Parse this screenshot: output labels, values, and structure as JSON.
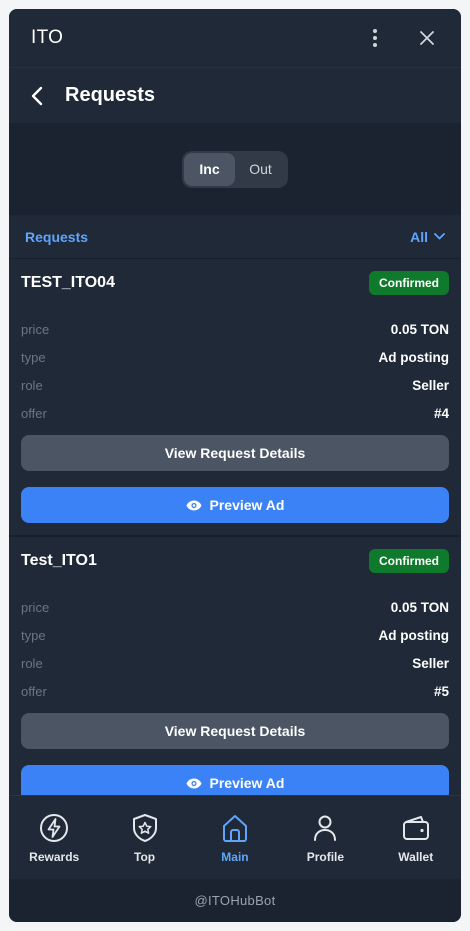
{
  "titlebar": {
    "app_title": "ITO"
  },
  "header": {
    "title": "Requests"
  },
  "segment": {
    "options": [
      "Inc",
      "Out"
    ],
    "selected": "Inc"
  },
  "requests": {
    "section_label": "Requests",
    "filter_label": "All",
    "items": [
      {
        "title": "TEST_ITO04",
        "status": "Confirmed",
        "fields": [
          {
            "key": "price",
            "value": "0.05 TON"
          },
          {
            "key": "type",
            "value": "Ad posting"
          },
          {
            "key": "role",
            "value": "Seller"
          },
          {
            "key": "offer",
            "value": "#4"
          }
        ],
        "details_label": "View Request Details",
        "preview_label": "Preview Ad"
      },
      {
        "title": "Test_ITO1",
        "status": "Confirmed",
        "fields": [
          {
            "key": "price",
            "value": "0.05 TON"
          },
          {
            "key": "type",
            "value": "Ad posting"
          },
          {
            "key": "role",
            "value": "Seller"
          },
          {
            "key": "offer",
            "value": "#5"
          }
        ],
        "details_label": "View Request Details",
        "preview_label": "Preview Ad"
      }
    ]
  },
  "nav": {
    "items": [
      {
        "label": "Rewards",
        "icon": "lightning-icon"
      },
      {
        "label": "Top",
        "icon": "shield-star-icon"
      },
      {
        "label": "Main",
        "icon": "home-icon",
        "active": true
      },
      {
        "label": "Profile",
        "icon": "person-icon"
      },
      {
        "label": "Wallet",
        "icon": "wallet-icon"
      }
    ]
  },
  "footer": {
    "bot_handle": "@ITOHubBot"
  },
  "colors": {
    "background": "#1f2937",
    "accent": "#3b82f6",
    "link": "#60a5fa",
    "badge": "#0f7a2c",
    "button_grey": "#4b5563"
  }
}
